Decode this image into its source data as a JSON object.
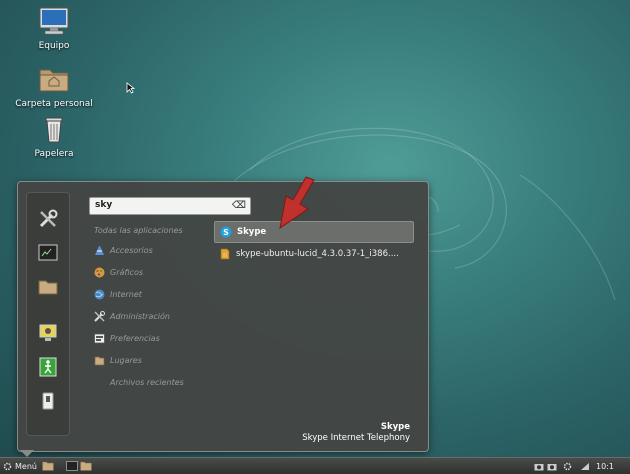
{
  "desktop": {
    "icons": [
      {
        "label": "Equipo"
      },
      {
        "label": "Carpeta personal"
      },
      {
        "label": "Papelera"
      }
    ]
  },
  "menu": {
    "search_value": "sky",
    "favorites": [
      "preferences-icon",
      "terminal-icon",
      "folder-icon",
      "lock-screen-icon",
      "logout-icon",
      "shutdown-icon"
    ],
    "categories": [
      {
        "label": "Todas las aplicaciones",
        "icon": ""
      },
      {
        "label": "Accesorios",
        "icon": "accessories-icon"
      },
      {
        "label": "Gráficos",
        "icon": "graphics-icon"
      },
      {
        "label": "Internet",
        "icon": "internet-icon"
      },
      {
        "label": "Administración",
        "icon": "administration-icon"
      },
      {
        "label": "Preferencias",
        "icon": "preferences-icon"
      },
      {
        "label": "Lugares",
        "icon": "places-icon"
      },
      {
        "label": "Archivos recientes",
        "icon": ""
      }
    ],
    "results": [
      {
        "label": "Skype",
        "icon": "skype-icon",
        "selected": true
      },
      {
        "label": "skype-ubuntu-lucid_4.3.0.37-1_i386....",
        "icon": "package-icon",
        "selected": false
      }
    ],
    "info": {
      "title": "Skype",
      "description": "Skype Internet Telephony"
    }
  },
  "taskbar": {
    "menu_label": "Menú",
    "clock": "10:1"
  },
  "colors": {
    "accent_arrow": "#c0302c",
    "selection": "#6b6e6b"
  }
}
